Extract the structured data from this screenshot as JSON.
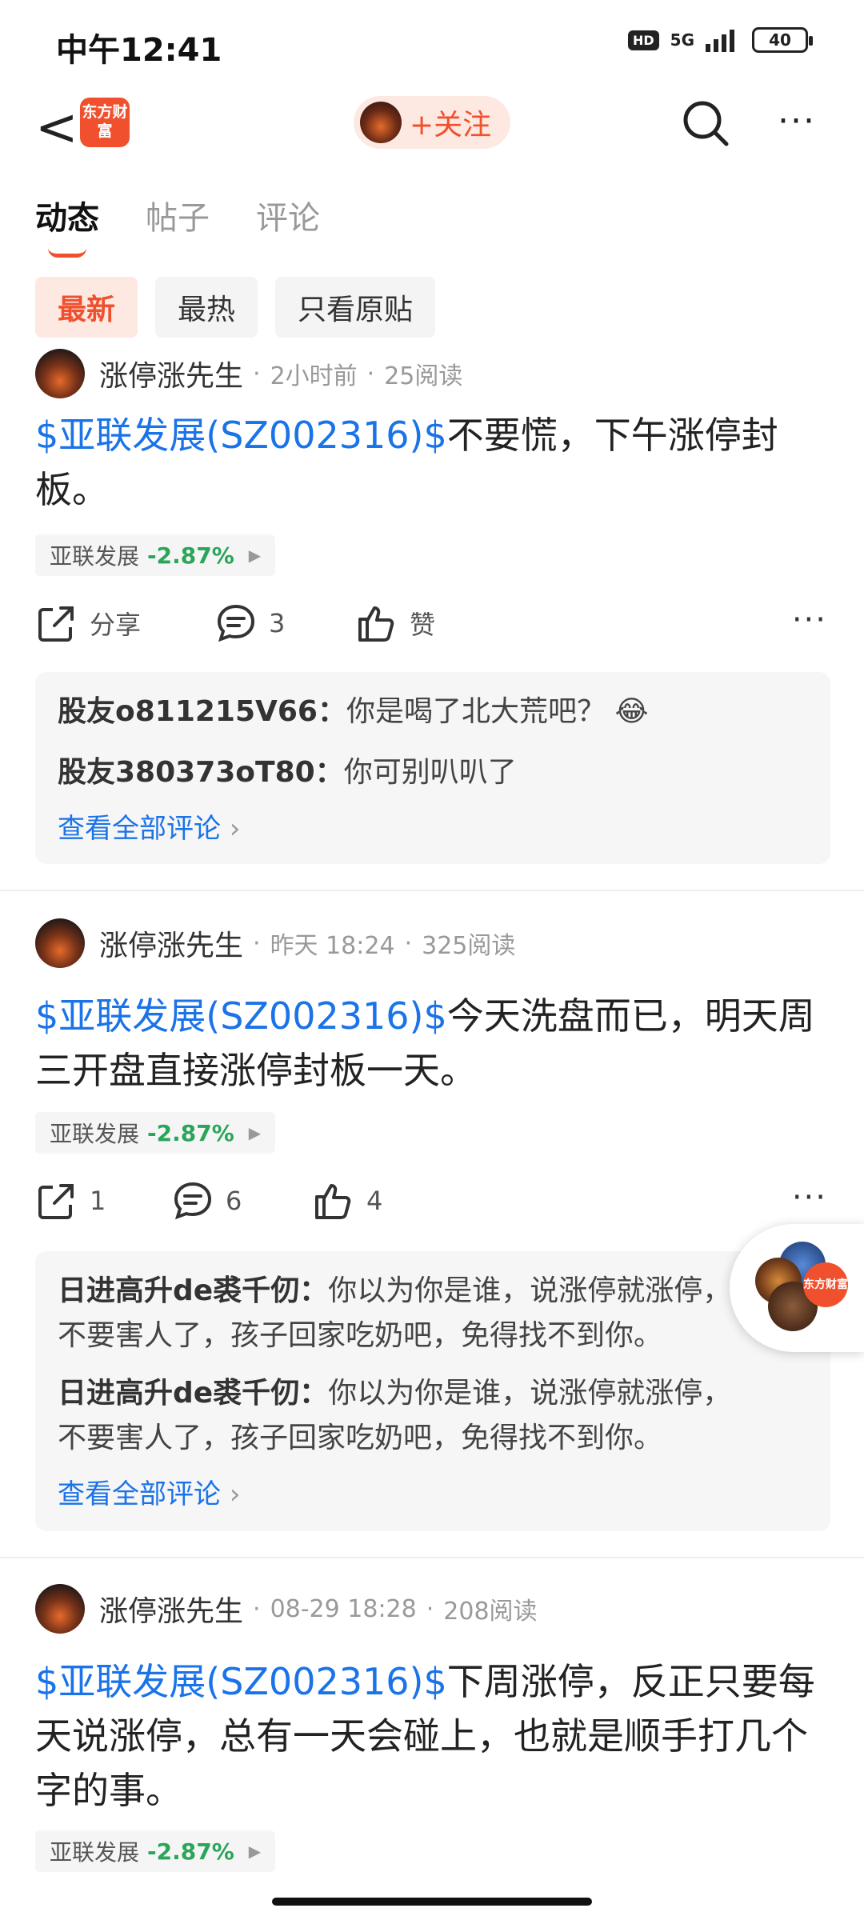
{
  "status_bar": {
    "time": "中午12:41",
    "hd": "HD",
    "network": "5G",
    "battery": "40"
  },
  "nav": {
    "back": "<",
    "logo_text": "东方财富",
    "follow_label": "+关注",
    "icons": [
      "back-icon",
      "search-icon",
      "more-icon"
    ]
  },
  "tabs": [
    {
      "label": "动态",
      "active": true
    },
    {
      "label": "帖子",
      "active": false
    },
    {
      "label": "评论",
      "active": false
    }
  ],
  "filters": [
    {
      "label": "最新",
      "active": true
    },
    {
      "label": "最热",
      "active": false
    },
    {
      "label": "只看原贴",
      "active": false
    }
  ],
  "posts": [
    {
      "author": "涨停涨先生",
      "time": "2小时前",
      "reads": "25阅读",
      "tag": "$亚联发展(SZ002316)$",
      "text": "不要慌，下午涨停封板。",
      "stock": {
        "name": "亚联发展",
        "change": "-2.87%"
      },
      "share": "分享",
      "comment_count": "3",
      "like": "赞",
      "comments": [
        {
          "user": "股友o811215V66：",
          "text": "你是喝了北大荒吧？"
        },
        {
          "user": "股友380373oT80：",
          "text": "你可别叭叭了"
        }
      ],
      "view_all": "查看全部评论"
    },
    {
      "author": "涨停涨先生",
      "time": "昨天 18:24",
      "reads": "325阅读",
      "tag": "$亚联发展(SZ002316)$",
      "text": "今天洗盘而已，明天周三开盘直接涨停封板一天。",
      "stock": {
        "name": "亚联发展",
        "change": "-2.87%"
      },
      "share": "1",
      "comment_count": "6",
      "like": "4",
      "comments": [
        {
          "user": "日进高升de裘千仞：",
          "text": "你以为你是谁，说涨停就涨停，不要害人了，孩子回家吃奶吧，免得找不到你。"
        },
        {
          "user": "日进高升de裘千仞：",
          "text": "你以为你是谁，说涨停就涨停，不要害人了，孩子回家吃奶吧，免得找不到你。"
        }
      ],
      "view_all": "查看全部评论"
    },
    {
      "author": "涨停涨先生",
      "time": "08-29 18:28",
      "reads": "208阅读",
      "tag": "$亚联发展(SZ002316)$",
      "text": "下周涨停，反正只要每天说涨停，总有一天会碰上，也就是顺手打几个字的事。",
      "stock": {
        "name": "亚联发展",
        "change": "-2.87%"
      }
    }
  ],
  "floating": {
    "logo": "东方财富"
  },
  "colors": {
    "accent": "#f0502d",
    "link": "#1a73e8",
    "down": "#2aa55a"
  }
}
